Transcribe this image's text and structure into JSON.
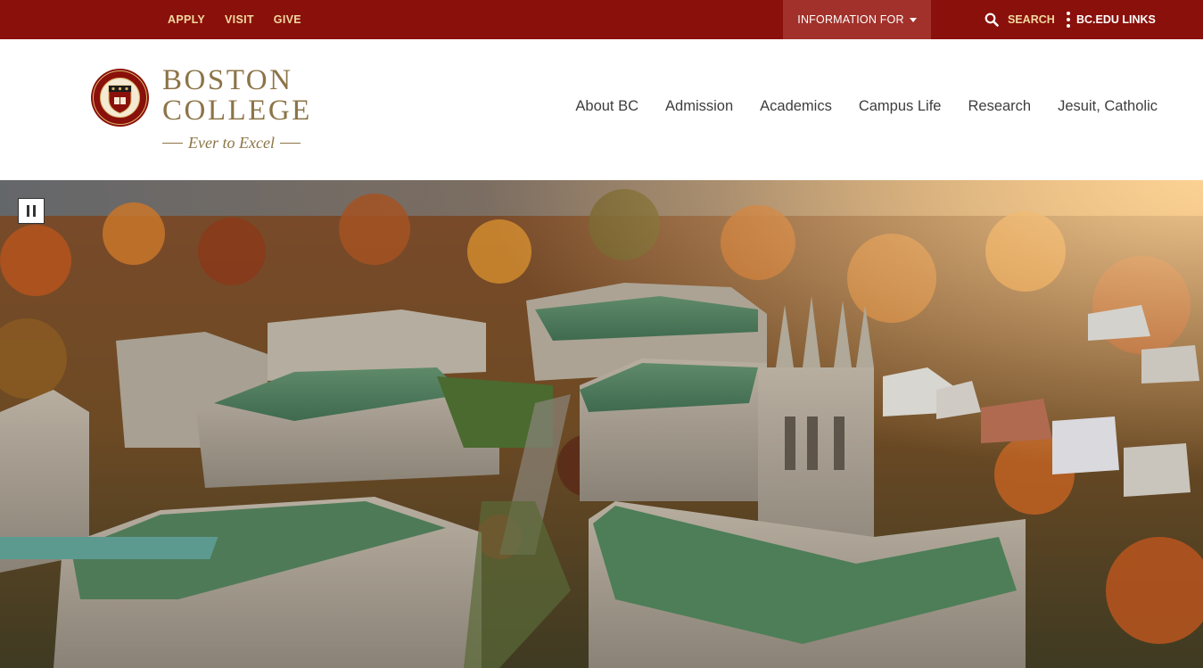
{
  "topbar": {
    "links": [
      "APPLY",
      "VISIT",
      "GIVE"
    ],
    "info_for": "INFORMATION FOR",
    "search": "SEARCH",
    "bc_links": "BC.EDU LINKS",
    "bg_color": "#8a100b",
    "link_color": "#f2d9a0"
  },
  "logo": {
    "line1": "BOSTON",
    "line2": "COLLEGE",
    "motto": "Ever to Excel",
    "seal_icon": "university-seal-icon",
    "color": "#8c7447"
  },
  "nav": {
    "items": [
      "About BC",
      "Admission",
      "Academics",
      "Campus Life",
      "Research",
      "Jesuit, Catholic"
    ]
  },
  "hero": {
    "image": "aerial-campus-autumn-photo",
    "pause_icon": "pause-icon"
  }
}
